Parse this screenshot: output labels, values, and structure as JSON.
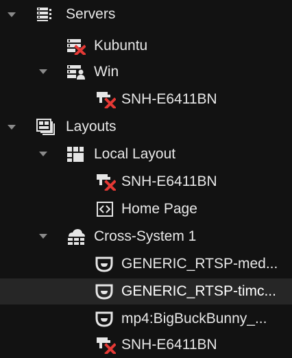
{
  "tree": {
    "servers": {
      "label": "Servers",
      "icon": "server-stack-icon",
      "children": {
        "kubuntu": {
          "label": "Kubuntu",
          "icon": "server-error-icon"
        },
        "win": {
          "label": "Win",
          "icon": "server-user-icon",
          "children": {
            "camera": {
              "label": "SNH-E6411BN",
              "icon": "camera-offline-icon"
            }
          }
        }
      }
    },
    "layouts": {
      "label": "Layouts",
      "icon": "layouts-icon",
      "children": {
        "local_layout": {
          "label": "Local Layout",
          "icon": "layout-grid-icon",
          "children": {
            "camera": {
              "label": "SNH-E6411BN",
              "icon": "camera-offline-icon"
            },
            "home_page": {
              "label": "Home Page",
              "icon": "webpage-icon"
            }
          }
        },
        "cross_system": {
          "label": "Cross-System 1",
          "icon": "cloud-layout-icon",
          "children": {
            "item1": {
              "label": "GENERIC_RTSP-med...",
              "icon": "camera-dome-icon"
            },
            "item2": {
              "label": "GENERIC_RTSP-timc...",
              "icon": "camera-dome-icon"
            },
            "item3": {
              "label": "mp4:BigBuckBunny_...",
              "icon": "camera-dome-icon"
            },
            "item4": {
              "label": "SNH-E6411BN",
              "icon": "camera-offline-icon"
            }
          }
        }
      }
    }
  },
  "colors": {
    "background": "#121212",
    "selected_row": "#262626",
    "error_red": "#e53935",
    "icon_light": "#e6e6e6"
  }
}
